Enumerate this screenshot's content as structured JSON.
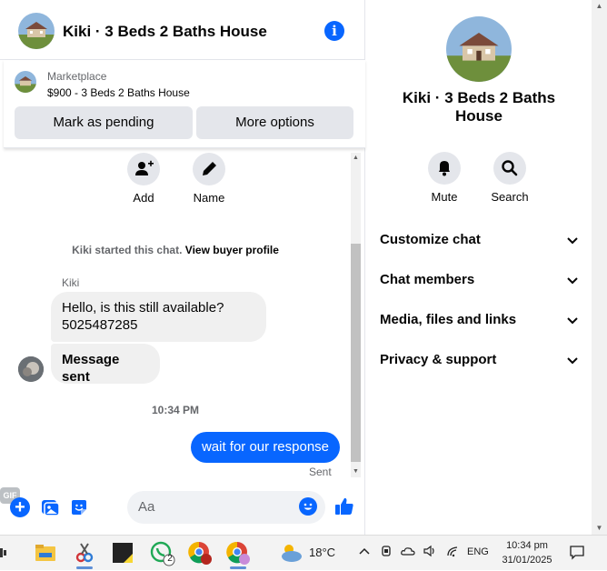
{
  "header": {
    "title": "Kiki · 3 Beds 2 Baths House",
    "info_icon": "info-icon"
  },
  "listing": {
    "category": "Marketplace",
    "title": "$900 - 3 Beds 2 Baths House",
    "mark_pending_label": "Mark as pending",
    "more_options_label": "More options"
  },
  "thread": {
    "actions": [
      {
        "label": "Add",
        "icon": "add-person-icon"
      },
      {
        "label": "Name",
        "icon": "pencil-icon"
      }
    ],
    "started_text": "Kiki started this chat.",
    "view_profile_label": "View buyer profile",
    "sender_name": "Kiki",
    "incoming_1_line1": "Hello, is this still available?",
    "incoming_1_line2": "5025487285",
    "incoming_2": "Message sent",
    "timestamp": "10:34 PM",
    "outgoing": "wait for our response",
    "status": "Sent"
  },
  "composer": {
    "placeholder": "Aa",
    "gif_label": "GIF"
  },
  "details": {
    "name": "Kiki · 3 Beds 2 Baths House",
    "actions": [
      {
        "label": "Mute",
        "icon": "bell-icon"
      },
      {
        "label": "Search",
        "icon": "search-icon"
      }
    ],
    "rows": [
      {
        "label": "Customize chat"
      },
      {
        "label": "Chat members"
      },
      {
        "label": "Media, files and links"
      },
      {
        "label": "Privacy & support"
      }
    ]
  },
  "taskbar": {
    "whatsapp_badge": "2",
    "temperature": "18°C",
    "language": "ENG",
    "time": "10:34 pm",
    "date": "31/01/2025"
  },
  "colors": {
    "accent": "#0866ff",
    "bubble_in": "#f0f0f0",
    "button_bg": "#e4e6eb"
  }
}
